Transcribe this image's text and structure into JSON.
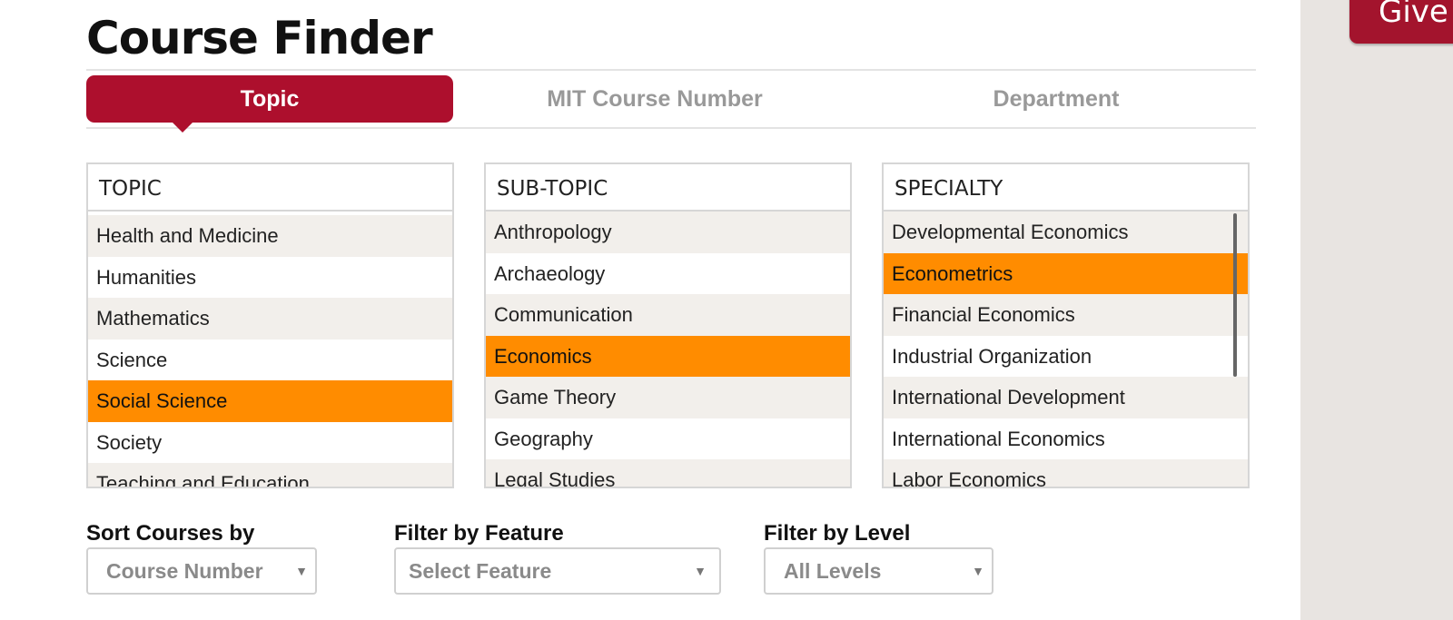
{
  "page": {
    "title": "Course Finder"
  },
  "give_button": {
    "label": "Give"
  },
  "tabs": [
    {
      "label": "Topic",
      "active": true
    },
    {
      "label": "MIT Course Number",
      "active": false
    },
    {
      "label": "Department",
      "active": false
    }
  ],
  "topic": {
    "header": "TOPIC",
    "items": [
      "Health and Medicine",
      "Humanities",
      "Mathematics",
      "Science",
      "Social Science",
      "Society",
      "Teaching and Education"
    ],
    "selected": "Social Science"
  },
  "subtopic": {
    "header": "SUB-TOPIC",
    "items": [
      "Anthropology",
      "Archaeology",
      "Communication",
      "Economics",
      "Game Theory",
      "Geography",
      "Legal Studies"
    ],
    "selected": "Economics"
  },
  "specialty": {
    "header": "SPECIALTY",
    "items": [
      "Developmental Economics",
      "Econometrics",
      "Financial Economics",
      "Industrial Organization",
      "International Development",
      "International Economics",
      "Labor Economics"
    ],
    "selected": "Econometrics"
  },
  "filters": {
    "sort": {
      "label": "Sort Courses by",
      "value": "Course Number"
    },
    "feature": {
      "label": "Filter by Feature",
      "value": "Select Feature"
    },
    "level": {
      "label": "Filter by Level",
      "value": "All Levels"
    }
  },
  "icons": {
    "dropdown": "chevron-down-icon"
  },
  "colors": {
    "accent": "#ad0f2d",
    "selected": "#ff8c00",
    "sidebar": "#e8e4e1"
  }
}
